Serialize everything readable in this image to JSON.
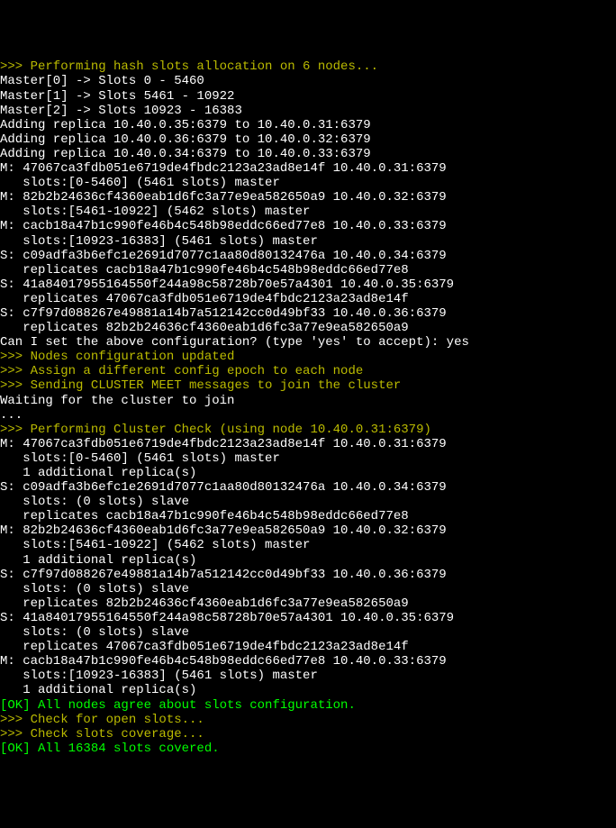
{
  "lines": [
    {
      "style": "prompt",
      "text": ">>> Performing hash slots allocation on 6 nodes..."
    },
    {
      "style": "",
      "text": "Master[0] -> Slots 0 - 5460"
    },
    {
      "style": "",
      "text": "Master[1] -> Slots 5461 - 10922"
    },
    {
      "style": "",
      "text": "Master[2] -> Slots 10923 - 16383"
    },
    {
      "style": "",
      "text": "Adding replica 10.40.0.35:6379 to 10.40.0.31:6379"
    },
    {
      "style": "",
      "text": "Adding replica 10.40.0.36:6379 to 10.40.0.32:6379"
    },
    {
      "style": "",
      "text": "Adding replica 10.40.0.34:6379 to 10.40.0.33:6379"
    },
    {
      "style": "",
      "text": "M: 47067ca3fdb051e6719de4fbdc2123a23ad8e14f 10.40.0.31:6379"
    },
    {
      "style": "",
      "text": "   slots:[0-5460] (5461 slots) master"
    },
    {
      "style": "",
      "text": "M: 82b2b24636cf4360eab1d6fc3a77e9ea582650a9 10.40.0.32:6379"
    },
    {
      "style": "",
      "text": "   slots:[5461-10922] (5462 slots) master"
    },
    {
      "style": "",
      "text": "M: cacb18a47b1c990fe46b4c548b98eddc66ed77e8 10.40.0.33:6379"
    },
    {
      "style": "",
      "text": "   slots:[10923-16383] (5461 slots) master"
    },
    {
      "style": "",
      "text": "S: c09adfa3b6efc1e2691d7077c1aa80d80132476a 10.40.0.34:6379"
    },
    {
      "style": "",
      "text": "   replicates cacb18a47b1c990fe46b4c548b98eddc66ed77e8"
    },
    {
      "style": "",
      "text": "S: 41a84017955164550f244a98c58728b70e57a4301 10.40.0.35:6379"
    },
    {
      "style": "",
      "text": "   replicates 47067ca3fdb051e6719de4fbdc2123a23ad8e14f"
    },
    {
      "style": "",
      "text": "S: c7f97d088267e49881a14b7a512142cc0d49bf33 10.40.0.36:6379"
    },
    {
      "style": "",
      "text": "   replicates 82b2b24636cf4360eab1d6fc3a77e9ea582650a9"
    },
    {
      "style": "",
      "text": "Can I set the above configuration? (type 'yes' to accept): yes"
    },
    {
      "style": "prompt",
      "text": ">>> Nodes configuration updated"
    },
    {
      "style": "prompt",
      "text": ">>> Assign a different config epoch to each node"
    },
    {
      "style": "prompt",
      "text": ">>> Sending CLUSTER MEET messages to join the cluster"
    },
    {
      "style": "",
      "text": "Waiting for the cluster to join"
    },
    {
      "style": "",
      "text": "..."
    },
    {
      "style": "prompt",
      "text": ">>> Performing Cluster Check (using node 10.40.0.31:6379)"
    },
    {
      "style": "",
      "text": "M: 47067ca3fdb051e6719de4fbdc2123a23ad8e14f 10.40.0.31:6379"
    },
    {
      "style": "",
      "text": "   slots:[0-5460] (5461 slots) master"
    },
    {
      "style": "",
      "text": "   1 additional replica(s)"
    },
    {
      "style": "",
      "text": "S: c09adfa3b6efc1e2691d7077c1aa80d80132476a 10.40.0.34:6379"
    },
    {
      "style": "",
      "text": "   slots: (0 slots) slave"
    },
    {
      "style": "",
      "text": "   replicates cacb18a47b1c990fe46b4c548b98eddc66ed77e8"
    },
    {
      "style": "",
      "text": "M: 82b2b24636cf4360eab1d6fc3a77e9ea582650a9 10.40.0.32:6379"
    },
    {
      "style": "",
      "text": "   slots:[5461-10922] (5462 slots) master"
    },
    {
      "style": "",
      "text": "   1 additional replica(s)"
    },
    {
      "style": "",
      "text": "S: c7f97d088267e49881a14b7a512142cc0d49bf33 10.40.0.36:6379"
    },
    {
      "style": "",
      "text": "   slots: (0 slots) slave"
    },
    {
      "style": "",
      "text": "   replicates 82b2b24636cf4360eab1d6fc3a77e9ea582650a9"
    },
    {
      "style": "",
      "text": "S: 41a84017955164550f244a98c58728b70e57a4301 10.40.0.35:6379"
    },
    {
      "style": "",
      "text": "   slots: (0 slots) slave"
    },
    {
      "style": "",
      "text": "   replicates 47067ca3fdb051e6719de4fbdc2123a23ad8e14f"
    },
    {
      "style": "",
      "text": "M: cacb18a47b1c990fe46b4c548b98eddc66ed77e8 10.40.0.33:6379"
    },
    {
      "style": "",
      "text": "   slots:[10923-16383] (5461 slots) master"
    },
    {
      "style": "",
      "text": "   1 additional replica(s)"
    },
    {
      "style": "ok",
      "text": "[OK] All nodes agree about slots configuration."
    },
    {
      "style": "prompt",
      "text": ">>> Check for open slots..."
    },
    {
      "style": "prompt",
      "text": ">>> Check slots coverage..."
    },
    {
      "style": "ok",
      "text": "[OK] All 16384 slots covered."
    }
  ]
}
